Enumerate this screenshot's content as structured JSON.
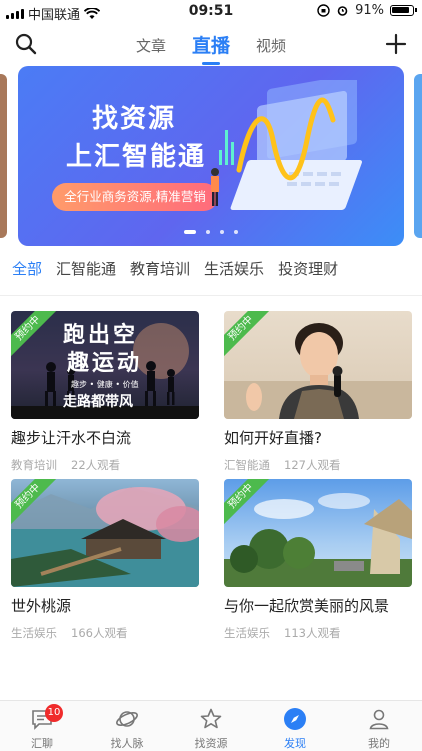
{
  "status_bar": {
    "carrier": "中国联通",
    "time": "09:51",
    "battery": "91%"
  },
  "header": {
    "tabs": [
      {
        "label": "文章"
      },
      {
        "label": "直播"
      },
      {
        "label": "视频"
      }
    ],
    "active_tab": "直播",
    "search_icon": "search-icon",
    "add_icon": "plus-icon"
  },
  "banner": {
    "title_line1": "找资源",
    "title_line2": "上汇智能通",
    "pill_text": "全行业商务资源,精准营销",
    "page_count": 4,
    "active_page": 1
  },
  "categories": [
    {
      "label": "全部"
    },
    {
      "label": "汇智能通"
    },
    {
      "label": "教育培训"
    },
    {
      "label": "生活娱乐"
    },
    {
      "label": "投资理财"
    }
  ],
  "cards": [
    {
      "badge": "预约中",
      "title": "趣步让汗水不白流",
      "category": "教育培训",
      "views": "22人观看",
      "thumb_text_1": "跑出空",
      "thumb_text_2": "趣运动",
      "thumb_text_3": "趣步 • 健康 • 价值",
      "thumb_text_4": "走路都带风"
    },
    {
      "badge": "预约中",
      "title": "如何开好直播?",
      "category": "汇智能通",
      "views": "127人观看"
    },
    {
      "badge": "预约中",
      "title": "世外桃源",
      "category": "生活娱乐",
      "views": "166人观看"
    },
    {
      "badge": "预约中",
      "title": "与你一起欣赏美丽的风景",
      "category": "生活娱乐",
      "views": "113人观看"
    }
  ],
  "tabbar": {
    "items": [
      {
        "label": "汇聊",
        "icon": "chat-icon",
        "badge": "10"
      },
      {
        "label": "找人脉",
        "icon": "planet-icon"
      },
      {
        "label": "找资源",
        "icon": "star-icon"
      },
      {
        "label": "发现",
        "icon": "compass-icon"
      },
      {
        "label": "我的",
        "icon": "person-icon"
      }
    ],
    "active": "发现"
  },
  "colors": {
    "accent": "#2b7ff5",
    "badge_red": "#f02b2b",
    "ribbon_green": "#4dba4d"
  }
}
